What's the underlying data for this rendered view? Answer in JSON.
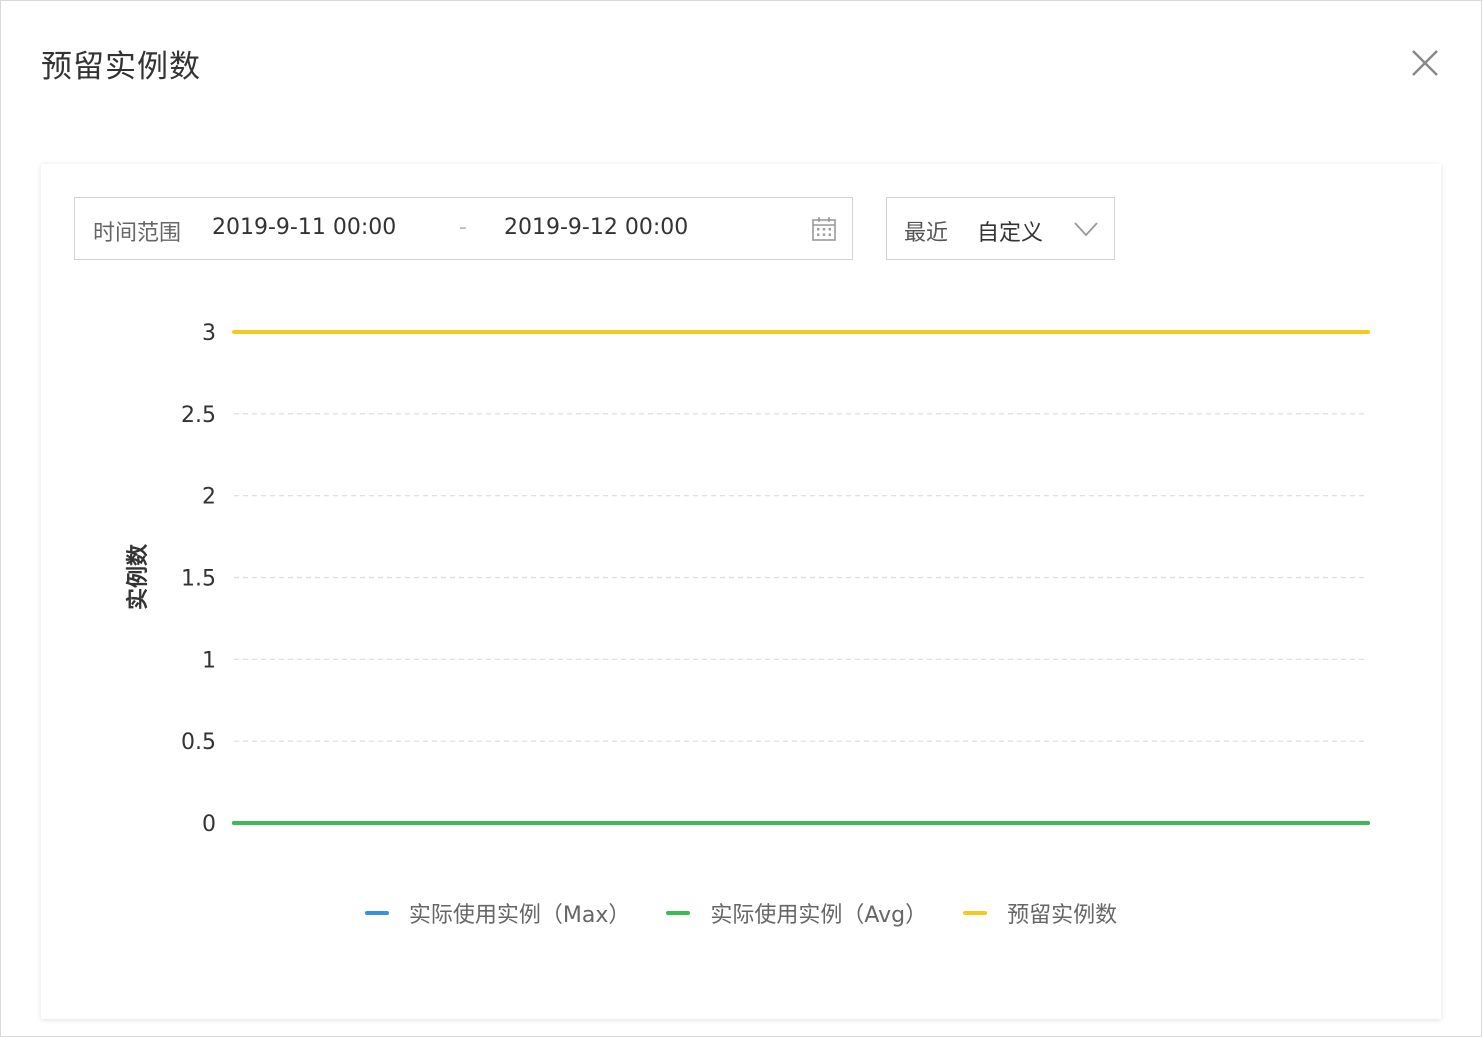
{
  "dialog": {
    "title": "预留实例数"
  },
  "filters": {
    "range_label": "时间范围",
    "start": "2019-9-11 00:00",
    "separator": "-",
    "end": "2019-9-12 00:00",
    "recent_label": "最近",
    "recent_value": "自定义"
  },
  "icons": {
    "close": "close-icon",
    "calendar": "calendar-icon",
    "dropdown": "chevron-down-icon"
  },
  "chart_data": {
    "type": "line",
    "title": "",
    "xlabel": "",
    "ylabel": "实例数",
    "ylim": [
      0,
      3
    ],
    "yticks": [
      "0",
      "0.5",
      "1",
      "1.5",
      "2",
      "2.5",
      "3"
    ],
    "grid": true,
    "legend_position": "bottom",
    "x": [
      "2019-9-11 00:00",
      "2019-9-12 00:00"
    ],
    "series": [
      {
        "name": "实际使用实例（Max）",
        "color": "#3a8ee6",
        "values": [
          0,
          0
        ]
      },
      {
        "name": "实际使用实例（Avg）",
        "color": "#3cba54",
        "values": [
          0,
          0
        ]
      },
      {
        "name": "预留实例数",
        "color": "#f2cb1d",
        "values": [
          3,
          3
        ]
      }
    ]
  }
}
